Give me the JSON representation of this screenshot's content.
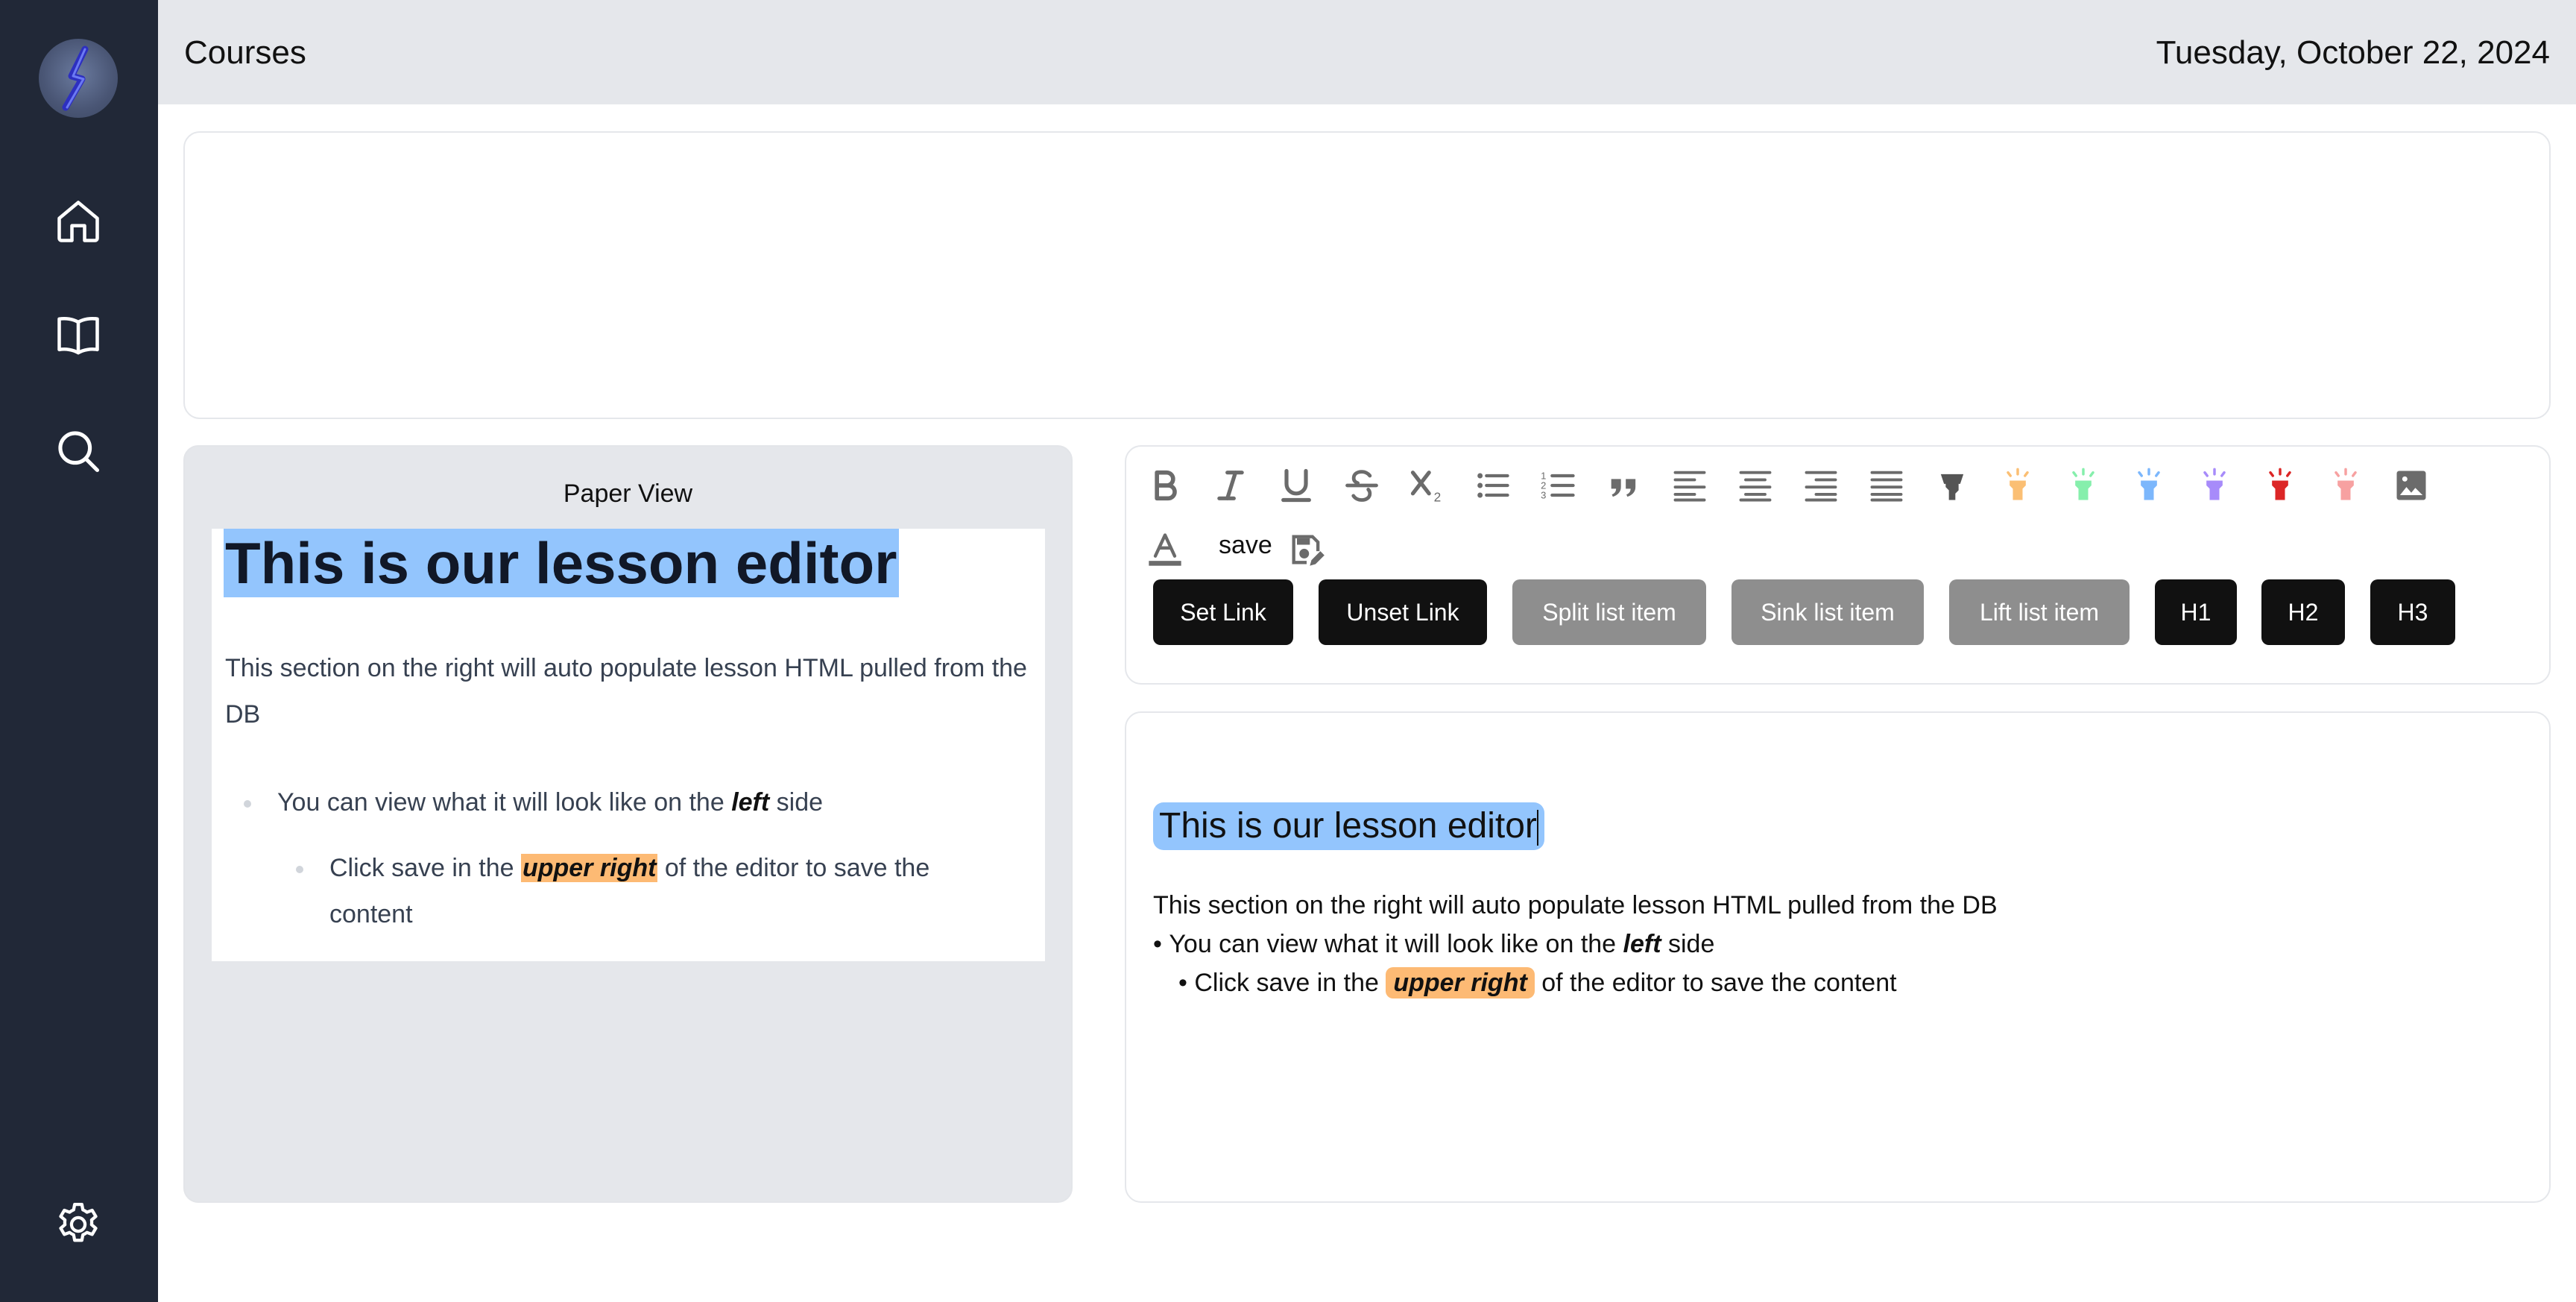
{
  "header": {
    "title": "Courses",
    "date": "Tuesday, October 22, 2024"
  },
  "sidebar": {
    "items": [
      {
        "icon": "home-icon"
      },
      {
        "icon": "book-icon"
      },
      {
        "icon": "search-icon"
      },
      {
        "icon": "gear-icon"
      }
    ]
  },
  "paper_view": {
    "label": "Paper View",
    "heading": "This is our lesson editor",
    "paragraph": "This section on the right will auto populate lesson HTML pulled from the DB",
    "bullet1": {
      "before": "You can view what it will look like on the ",
      "emphasis": "left",
      "after": " side"
    },
    "bullet2": {
      "before": "Click save in the ",
      "highlight": "upper right",
      "after": " of the editor to save the content"
    }
  },
  "toolbar": {
    "save_label": "save",
    "icons": [
      "bold-icon",
      "italic-icon",
      "underline-icon",
      "strikethrough-icon",
      "subscript-icon",
      "bullet-list-icon",
      "ordered-list-icon",
      "blockquote-icon",
      "align-left-icon",
      "align-center-icon",
      "align-right-icon",
      "align-justify-icon",
      "highlighter-black-icon",
      "highlighter-orange-icon",
      "highlighter-green-icon",
      "highlighter-blue-icon",
      "highlighter-purple-icon",
      "highlighter-red-icon",
      "highlighter-pink-icon",
      "image-icon"
    ],
    "highlight_colors": [
      "#555555",
      "#fbbf74",
      "#86efac",
      "#7cb7fc",
      "#a78bfa",
      "#dc2626",
      "#f7a1a1"
    ],
    "buttons": [
      {
        "label": "Set Link",
        "style": "dark"
      },
      {
        "label": "Unset Link",
        "style": "dark"
      },
      {
        "label": "Split list item",
        "style": "gray"
      },
      {
        "label": "Sink list item",
        "style": "gray"
      },
      {
        "label": "Lift list item",
        "style": "gray"
      },
      {
        "label": "H1",
        "style": "dark"
      },
      {
        "label": "H2",
        "style": "dark"
      },
      {
        "label": "H3",
        "style": "dark"
      }
    ]
  },
  "editor": {
    "heading": "This is our lesson editor",
    "paragraph": "This section on the right will auto populate lesson HTML pulled from the DB",
    "bullet1": {
      "before": "You can view what it will look like on the ",
      "emphasis": "left",
      "after": " side"
    },
    "bullet2": {
      "before": "Click save in the ",
      "highlight": "upper right",
      "after": " of the editor to save the content"
    }
  },
  "colors": {
    "sidebar_bg": "#212837",
    "topbar_bg": "#e5e7eb",
    "heading_highlight": "#93c5fd",
    "text_highlight": "#fdba74",
    "button_dark": "#111111",
    "button_gray": "#8e8e8e"
  }
}
